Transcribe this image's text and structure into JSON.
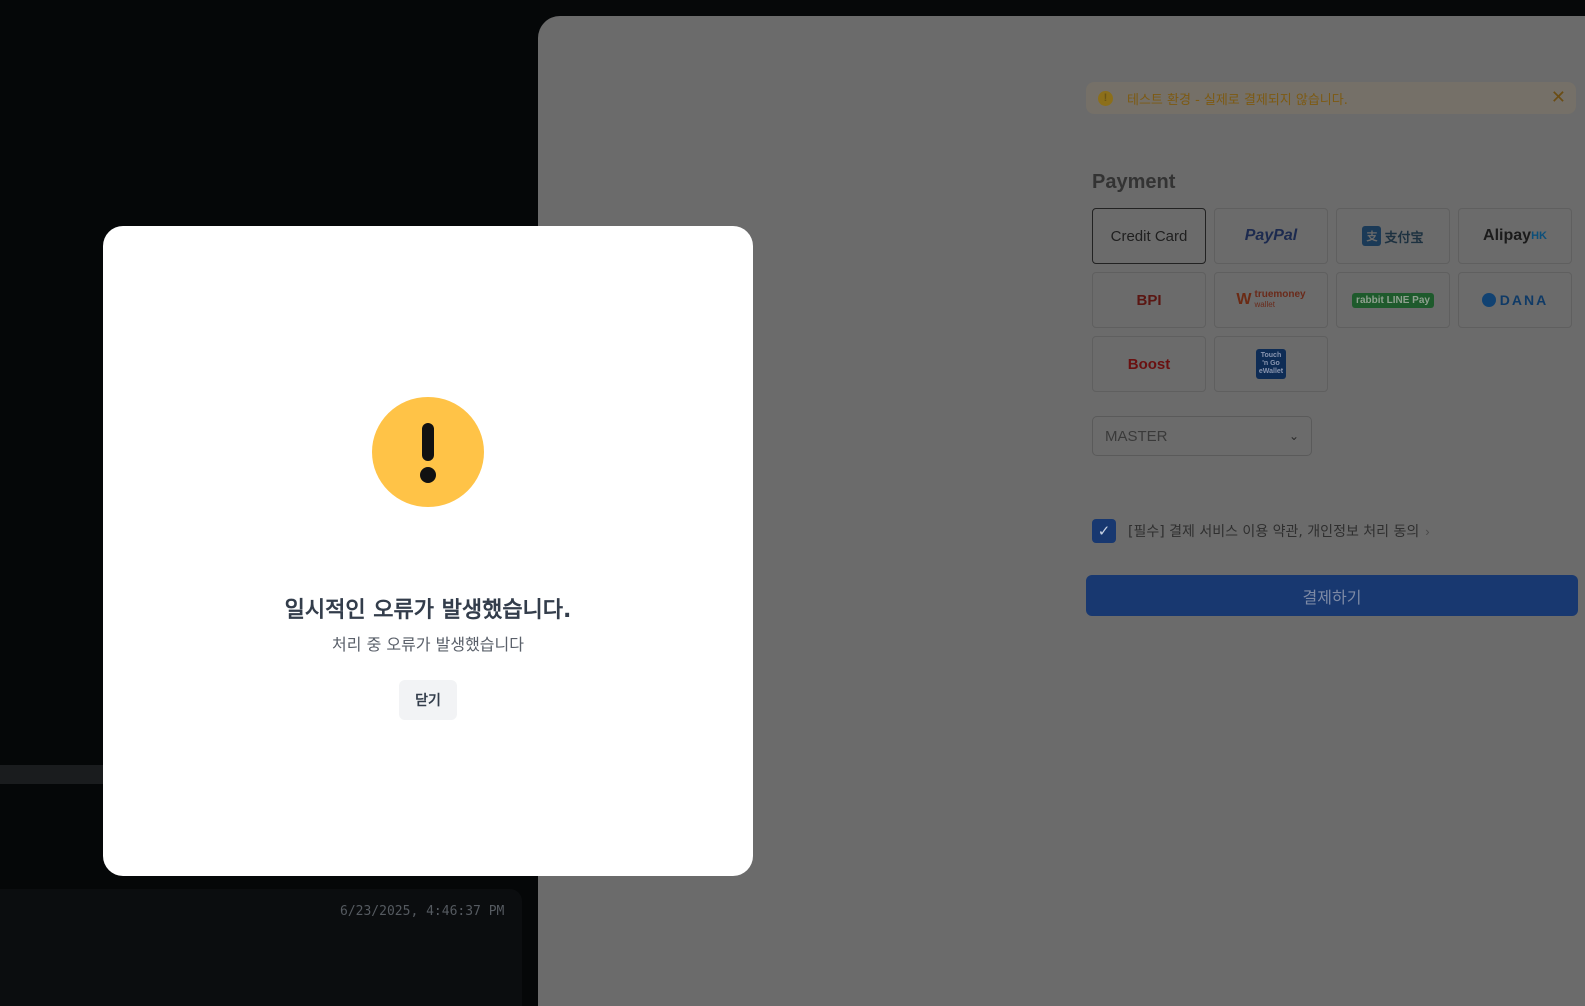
{
  "background": {
    "timestamp": "6/23/2025, 4:46:37 PM"
  },
  "payment": {
    "banner": {
      "text": "테스트 환경 - 실제로 결제되지 않습니다.",
      "icon": "warning-circle-icon",
      "close": "✕"
    },
    "title": "Payment",
    "methods": [
      {
        "id": "credit-card",
        "label": "Credit Card",
        "selected": true
      },
      {
        "id": "paypal",
        "label": "PayPal"
      },
      {
        "id": "alipay",
        "label": "支付宝"
      },
      {
        "id": "alipayhk",
        "label": "Alipay",
        "suffix": "HK"
      },
      {
        "id": "bpi",
        "label": "BPI"
      },
      {
        "id": "truemoney",
        "label": "truemoney",
        "sub": "wallet"
      },
      {
        "id": "rabbit-linepay",
        "label": "rabbit LINE Pay"
      },
      {
        "id": "dana",
        "label": "DANA"
      },
      {
        "id": "boost",
        "label": "Boost"
      },
      {
        "id": "touchngo",
        "label": "Touch 'n Go eWallet"
      }
    ],
    "card_select": {
      "value": "MASTER"
    },
    "agreement": {
      "text": "[필수] 결제 서비스 이용 약관, 개인정보 처리 동의",
      "checked": true
    },
    "submit_label": "결제하기"
  },
  "modal": {
    "icon": "exclamation-warning-icon",
    "title": "일시적인 오류가 발생했습니다.",
    "message": "처리 중 오류가 발생했습니다",
    "close_label": "닫기"
  },
  "colors": {
    "warning": "#ffc347",
    "primary": "#183870",
    "overlay": "#000000"
  }
}
